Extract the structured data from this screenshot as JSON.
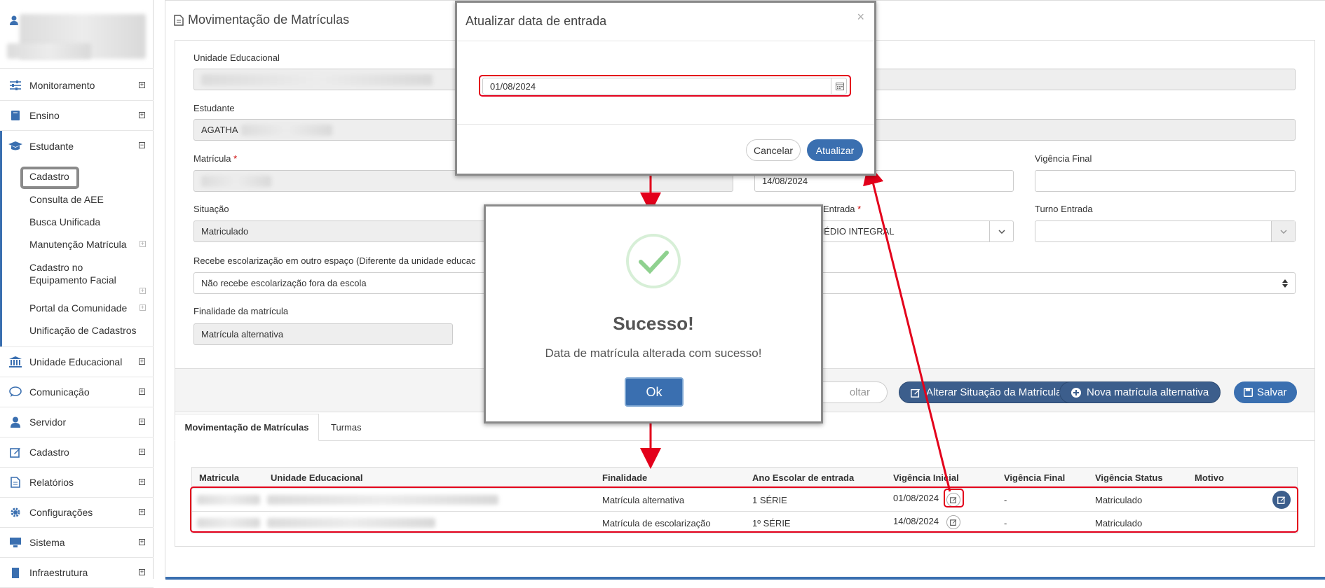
{
  "sidebar": {
    "items": [
      {
        "label": "Monitoramento"
      },
      {
        "label": "Ensino"
      },
      {
        "label": "Estudante"
      },
      {
        "label": "Unidade Educacional"
      },
      {
        "label": "Comunicação"
      },
      {
        "label": "Servidor"
      },
      {
        "label": "Cadastro"
      },
      {
        "label": "Relatórios"
      },
      {
        "label": "Configurações"
      },
      {
        "label": "Sistema"
      },
      {
        "label": "Infraestrutura"
      }
    ],
    "student_subitems": [
      {
        "label": "Cadastro"
      },
      {
        "label": "Consulta de AEE"
      },
      {
        "label": "Busca Unificada"
      },
      {
        "label": "Manutenção Matrícula"
      },
      {
        "label": "Cadastro no Equipamento Facial"
      },
      {
        "label": "Portal da Comunidade"
      },
      {
        "label": "Unificação de Cadastros"
      }
    ]
  },
  "page": {
    "title": "Movimentação de Matrículas"
  },
  "form": {
    "unidade_label": "Unidade Educacional",
    "estudante_label": "Estudante",
    "estudante_value": "AGATHA",
    "matricula_label": "Matrícula",
    "required_mark": "*",
    "vigencia_inicial_value": "14/08/2024",
    "vigencia_final_label": "Vigência Final",
    "situacao_label": "Situação",
    "situacao_value": "Matriculado",
    "ano_entrada_label_partial": "Entrada",
    "ano_entrada_value_partial": "IO MÉDIO INTEGRAL",
    "turno_entrada_label": "Turno Entrada",
    "escolarizacao_label": "Recebe escolarização em outro espaço (Diferente da unidade educac",
    "escolarizacao_value": "Não recebe escolarização fora da escola",
    "finalidade_label": "Finalidade da matrícula",
    "finalidade_value": "Matrícula alternativa"
  },
  "actions": {
    "voltar_partial": "oltar",
    "alterar_situacao": "Alterar Situação da Matrícula",
    "nova_matricula": "Nova matrícula alternativa",
    "salvar": "Salvar"
  },
  "tabs": [
    {
      "label": "Movimentação de Matrículas",
      "active": true
    },
    {
      "label": "Turmas",
      "active": false
    }
  ],
  "table": {
    "headers": [
      "Matricula",
      "Unidade Educacional",
      "Finalidade",
      "Ano Escolar de entrada",
      "Vigência Inicial",
      "Vigência Final",
      "Vigência Status",
      "Motivo"
    ],
    "rows": [
      {
        "finalidade": "Matrícula alternativa",
        "ano": "1 SÉRIE",
        "vigencia_inicial": "01/08/2024",
        "vigencia_final": "-",
        "status": "Matriculado"
      },
      {
        "finalidade": "Matrícula de escolarização",
        "ano": "1º SÉRIE",
        "vigencia_inicial": "14/08/2024",
        "vigencia_final": "-",
        "status": "Matriculado"
      }
    ]
  },
  "date_modal": {
    "title": "Atualizar data de entrada",
    "close": "×",
    "date_value": "01/08/2024",
    "cancel": "Cancelar",
    "update": "Atualizar"
  },
  "success_modal": {
    "title": "Sucesso!",
    "message": "Data de matrícula alterada com sucesso!",
    "ok": "Ok"
  },
  "colors": {
    "primary_dark": "#3c5e8c",
    "primary": "#3a6fb0",
    "highlight_red": "#e3001b",
    "success_green": "#8fd18f",
    "sidebar_active": "#3a6fb0"
  }
}
